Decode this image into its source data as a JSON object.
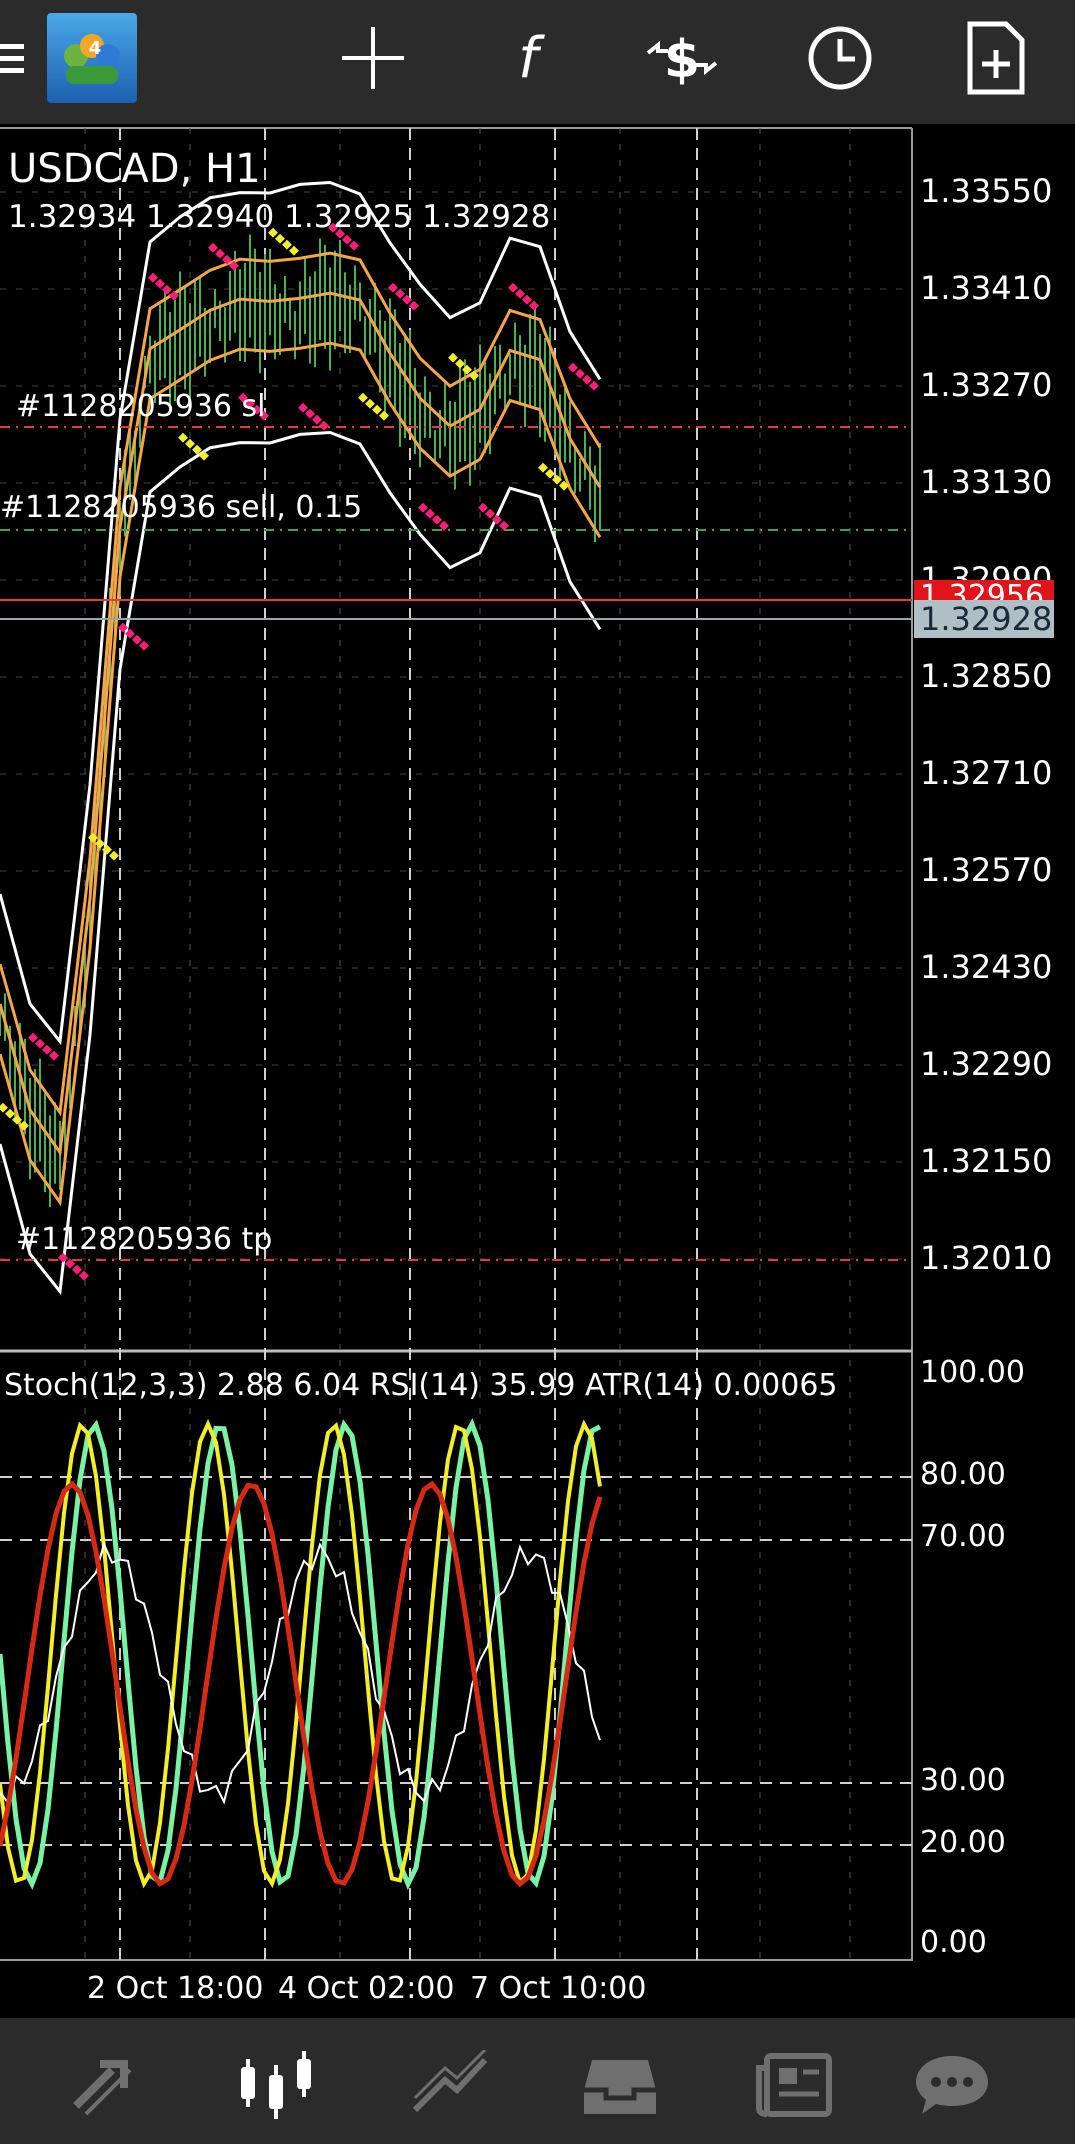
{
  "toolbar": {
    "icons": [
      "menu-icon",
      "mt4-logo",
      "crosshair-icon",
      "indicators-icon",
      "trade-icon",
      "timeframe-icon",
      "new-order-icon"
    ]
  },
  "symbol": {
    "name": "USDCAD, H1",
    "ohlc": "1.32934 1.32940 1.32925 1.32928"
  },
  "price_axis": {
    "labels": [
      "1.33550",
      "1.33410",
      "1.33270",
      "1.33130",
      "1.32990",
      "1.32850",
      "1.32710",
      "1.32570",
      "1.32430",
      "1.32290",
      "1.32150",
      "1.32010"
    ],
    "current_price": "1.32928",
    "line_price": "1.32956"
  },
  "orders": {
    "sl": "#1128205936 sl",
    "sell": "#1128205936 sell, 0.15",
    "tp": "#1128205936 tp"
  },
  "indicator_panel": {
    "title": "Stoch(12,3,3) 2.88 6.04 RSI(14) 35.99 ATR(14) 0.00065",
    "levels": [
      "100.00",
      "80.00",
      "70.00",
      "30.00",
      "20.00",
      "0.00"
    ]
  },
  "time_axis": {
    "labels": [
      "2 Oct 18:00",
      "4 Oct 02:00",
      "7 Oct 10:00"
    ]
  },
  "bottom_nav": [
    "quotes-icon",
    "chart-icon",
    "trade-icon",
    "history-icon",
    "news-icon",
    "chat-icon"
  ],
  "colors": {
    "toolbar": "#2b2b2b",
    "candles": "#4caf50",
    "envelope": "#ffffff",
    "bands": "#f4a64a",
    "sar_yellow": "#f2ef2a",
    "sar_pink": "#ff1f78",
    "stoch_main": "#79f2a4",
    "stoch_signal": "#f2ef2a",
    "rsi": "#ffffff",
    "atr": "#d52a14",
    "current_price_label": "#b0bec5",
    "order_line": "#e53935"
  }
}
